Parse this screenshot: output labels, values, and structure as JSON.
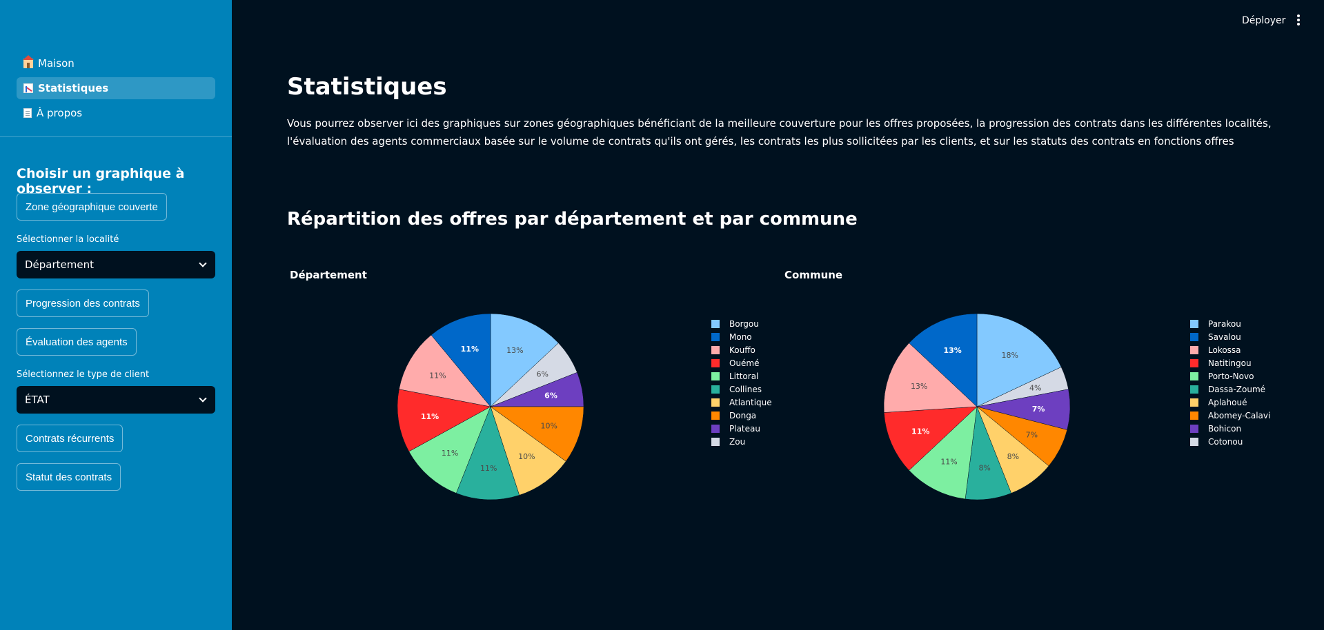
{
  "header": {
    "deploy_label": "Déployer",
    "menu_icon": "kebab-menu-icon"
  },
  "sidebar": {
    "nav": [
      {
        "label": "Maison",
        "icon": "house-icon",
        "active": false
      },
      {
        "label": "Statistiques",
        "icon": "chart-icon",
        "active": true
      },
      {
        "label": "À propos",
        "icon": "document-icon",
        "active": false
      }
    ],
    "heading": "Choisir un graphique à observer :",
    "btn_zone": "Zone géographique couverte",
    "locality_label": "Sélectionner la localité",
    "locality_value": "Département",
    "btn_progression": "Progression des contrats",
    "btn_evaluation": "Évaluation des agents",
    "client_label": "Sélectionnez le type de client",
    "client_value": "ÉTAT",
    "btn_recurrents": "Contrats récurrents",
    "btn_statut": "Statut des contrats"
  },
  "main": {
    "title": "Statistiques",
    "description": "Vous pourrez observer ici des graphiques sur zones géographiques bénéficiant de la meilleure couverture pour les offres proposées, la progression des contrats dans les différentes localités, l'évaluation des agents commerciaux basée sur le volume de contrats qu'ils ont gérés, les contrats les plus sollicitées par les clients, et sur les statuts des contrats en fonctions offres",
    "section_title": "Répartition des offres par département et par commune"
  },
  "colors": {
    "sidebar_bg": "#0082b9",
    "main_bg": "#00111f",
    "slice_colors": [
      "#83c9ff",
      "#0068c9",
      "#ffabab",
      "#ff2b2b",
      "#7defa1",
      "#29b09d",
      "#ffd16a",
      "#ff8700",
      "#6d3fc0",
      "#d5dae5"
    ]
  },
  "chart_data": [
    {
      "type": "pie",
      "title": "Département",
      "labels": [
        "Borgou",
        "Mono",
        "Kouffo",
        "Ouémé",
        "Littoral",
        "Collines",
        "Atlantique",
        "Donga",
        "Plateau",
        "Zou"
      ],
      "values": [
        13,
        11,
        11,
        11,
        11,
        11,
        10,
        10,
        6,
        6
      ],
      "display_labels": [
        "13%",
        "11%",
        "11%",
        "11%",
        "11%",
        "11%",
        "10%",
        "10%",
        "6%",
        "6%"
      ],
      "legend_position": "right",
      "direction": "clockwise",
      "clockwise_order": [
        "Borgou",
        "Zou",
        "Plateau",
        "Donga",
        "Atlantique",
        "Collines",
        "Littoral",
        "Ouémé",
        "Kouffo",
        "Mono"
      ]
    },
    {
      "type": "pie",
      "title": "Commune",
      "labels": [
        "Parakou",
        "Savalou",
        "Lokossa",
        "Natitingou",
        "Porto-Novo",
        "Dassa-Zoumé",
        "Aplahoué",
        "Abomey-Calavi",
        "Bohicon",
        "Cotonou"
      ],
      "values": [
        18,
        13,
        13,
        11,
        11,
        8,
        8,
        7,
        7,
        4
      ],
      "display_labels": [
        "18%",
        "13%",
        "13%",
        "11%",
        "11%",
        "8%",
        "8%",
        "7%",
        "7%",
        "4%"
      ],
      "legend_position": "right",
      "direction": "clockwise",
      "clockwise_order": [
        "Parakou",
        "Cotonou",
        "Bohicon",
        "Abomey-Calavi",
        "Aplahoué",
        "Dassa-Zoumé",
        "Porto-Novo",
        "Natitingou",
        "Lokossa",
        "Savalou"
      ]
    }
  ]
}
